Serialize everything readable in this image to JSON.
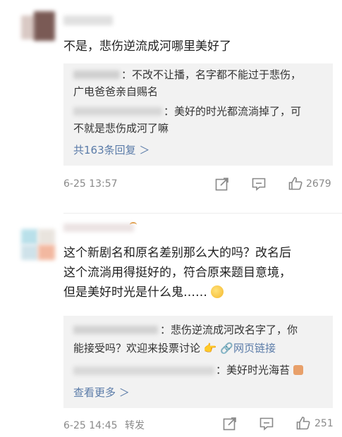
{
  "comments": [
    {
      "text": "不是，悲伤逆流成河哪里美好了",
      "replies": [
        {
          "text_line1": "：不改不让播，名字都不能过于悲伤，",
          "text_line2": "广电爸爸亲自赐名"
        },
        {
          "text_line1": "：美好的时光都流淌掉了，可",
          "text_line2": "不就是悲伤成河了嘛"
        }
      ],
      "more_label": "共163条回复 ＞",
      "time": "6-25 13:57",
      "likes": "2679"
    },
    {
      "text_line1": "这个新剧名和原名差别那么大的吗？改名后",
      "text_line2": "这个流淌用得挺好的，符合原来题目意境，",
      "text_line3": "但是美好时光是什么鬼……",
      "replies": [
        {
          "text_line1": "：悲伤逆流成河改名字了，你",
          "text_line2": "能接受吗？欢迎来投票讨论",
          "link_label": "网页链接"
        },
        {
          "text_line1": "：美好时光海苔"
        }
      ],
      "more_label": "查看更多 ＞",
      "time": "6-25 14:45",
      "forward_label": "转发",
      "likes": "251"
    }
  ],
  "colors": {
    "link": "#5a7ba8",
    "meta": "#8a8a8a",
    "reply_bg": "#f2f2f2"
  }
}
